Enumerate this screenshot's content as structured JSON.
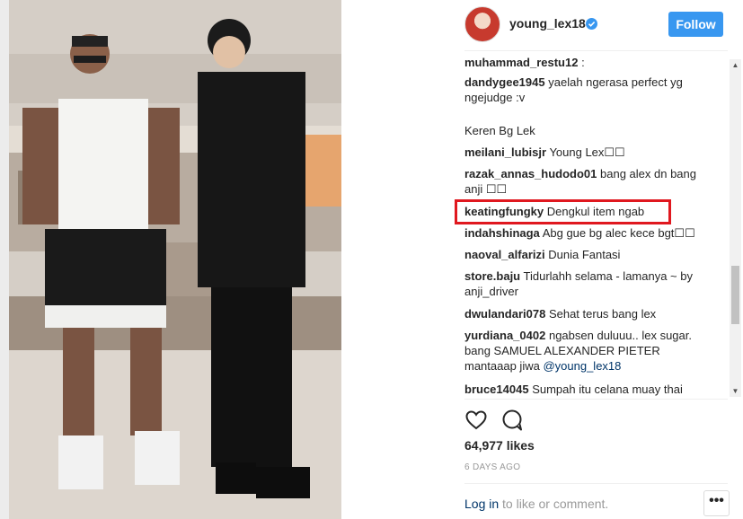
{
  "post": {
    "username": "young_lex18",
    "follow_label": "Follow"
  },
  "comments": [
    {
      "author": "muhammad_restu12",
      "text": ":"
    },
    {
      "author": "dandygee1945",
      "text": "yaelah ngerasa perfect yg ngejudge :v"
    },
    {
      "author": "",
      "text": "Keren Bg Lek"
    },
    {
      "author": "meilani_lubisjr",
      "text": "Young Lex☐☐"
    },
    {
      "author": "razak_annas_hudodo01",
      "text": "bang alex dn bang anji ☐☐"
    },
    {
      "author": "keatingfungky",
      "text": "Dengkul item ngab"
    },
    {
      "author": "indahshinaga",
      "text": "Abg gue bg alec kece bgt☐☐"
    },
    {
      "author": "naoval_alfarizi",
      "text": "Dunia Fantasi"
    },
    {
      "author": "store.baju",
      "text": "Tidurlahh selama - lamanya ~ by anji_driver"
    },
    {
      "author": "dwulandari078",
      "text": "Sehat terus bang lex"
    },
    {
      "author": "yurdiana_0402",
      "text": "ngabsen duluuu.. lex sugar. bang SAMUEL ALEXANDER PIETER mantaaap jiwa",
      "mention": "@young_lex18"
    },
    {
      "author": "bruce14045",
      "text": "Sumpah itu celana muay thai"
    }
  ],
  "likes": "64,977 likes",
  "time": "6 DAYS AGO",
  "login": {
    "link": "Log in",
    "rest": " to like or comment."
  },
  "more_label": "•••",
  "icons": {
    "like": "heart-icon",
    "comment": "comment-bubble-icon",
    "verified": "verified-badge-icon",
    "more": "more-options-icon"
  },
  "colors": {
    "follow": "#3897f0",
    "highlight": "#e0181f",
    "mention": "#003569"
  }
}
